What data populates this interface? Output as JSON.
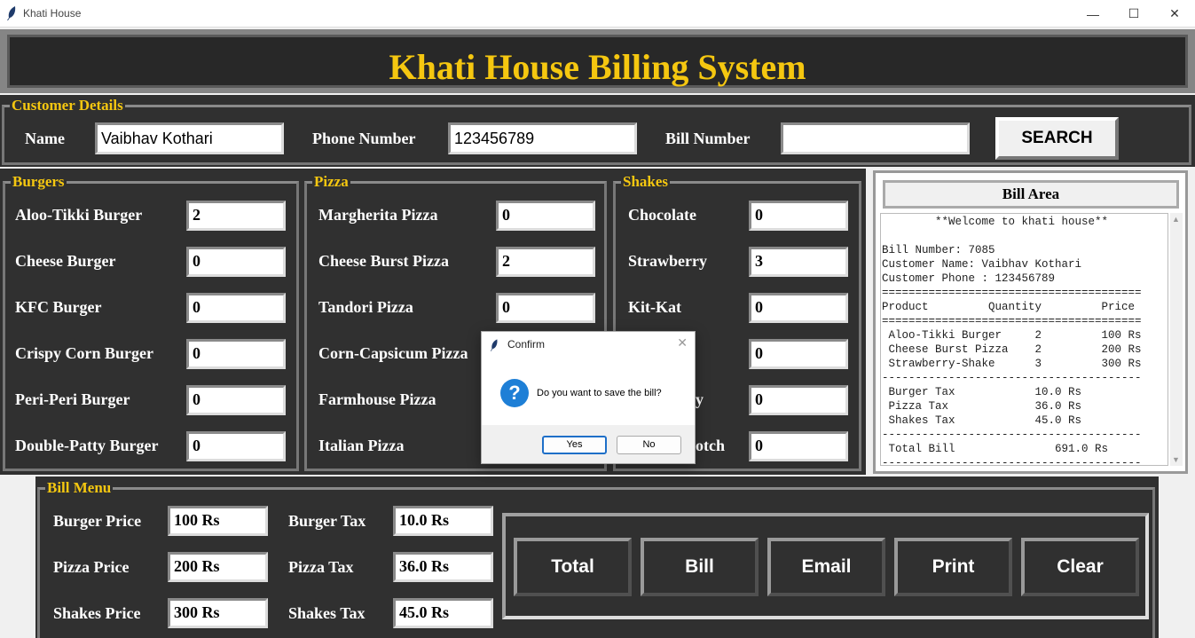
{
  "window": {
    "title": "Khati House",
    "minimize": "—",
    "maximize": "☐",
    "close": "✕"
  },
  "header": {
    "title": "Khati House Billing System"
  },
  "customer": {
    "legend": "Customer Details",
    "name_label": "Name",
    "name_value": "Vaibhav Kothari",
    "phone_label": "Phone Number",
    "phone_value": "123456789",
    "bill_label": "Bill Number",
    "bill_value": "",
    "search_label": "SEARCH"
  },
  "burgers": {
    "legend": "Burgers",
    "items": [
      {
        "label": "Aloo-Tikki Burger",
        "qty": "2"
      },
      {
        "label": "Cheese Burger",
        "qty": "0"
      },
      {
        "label": "KFC Burger",
        "qty": "0"
      },
      {
        "label": "Crispy Corn Burger",
        "qty": "0"
      },
      {
        "label": "Peri-Peri Burger",
        "qty": "0"
      },
      {
        "label": "Double-Patty Burger",
        "qty": "0"
      }
    ]
  },
  "pizza": {
    "legend": "Pizza",
    "items": [
      {
        "label": "Margherita Pizza",
        "qty": "0"
      },
      {
        "label": "Cheese Burst Pizza",
        "qty": "2"
      },
      {
        "label": "Tandori Pizza",
        "qty": "0"
      },
      {
        "label": "Corn-Capsicum Pizza",
        "qty": ""
      },
      {
        "label": "Farmhouse Pizza",
        "qty": ""
      },
      {
        "label": "Italian Pizza",
        "qty": ""
      }
    ]
  },
  "shakes": {
    "legend": "Shakes",
    "items": [
      {
        "label": "Chocolate",
        "qty": "0"
      },
      {
        "label": "Strawberry",
        "qty": "3"
      },
      {
        "label": "Kit-Kat",
        "qty": "0"
      },
      {
        "label": "",
        "qty": "0"
      },
      {
        "label": "ry",
        "qty": "0"
      },
      {
        "label": "otch",
        "qty": "0"
      }
    ]
  },
  "bill_area": {
    "title": "Bill Area",
    "lines": [
      "        **Welcome to khati house**",
      "",
      "Bill Number: 7085",
      "Customer Name: Vaibhav Kothari",
      "Customer Phone : 123456789",
      "=======================================",
      "Product         Quantity         Price",
      "=======================================",
      " Aloo-Tikki Burger     2         100 Rs",
      " Cheese Burst Pizza    2         200 Rs",
      " Strawberry-Shake      3         300 Rs",
      "---------------------------------------",
      " Burger Tax            10.0 Rs",
      " Pizza Tax             36.0 Rs",
      " Shakes Tax            45.0 Rs",
      "---------------------------------------",
      " Total Bill               691.0 Rs",
      "---------------------------------------"
    ]
  },
  "bill_menu": {
    "legend": "Bill Menu",
    "burger_price_label": "Burger Price",
    "burger_price": "100 Rs",
    "pizza_price_label": "Pizza Price",
    "pizza_price": "200 Rs",
    "shakes_price_label": "Shakes Price",
    "shakes_price": "300 Rs",
    "burger_tax_label": "Burger Tax",
    "burger_tax": "10.0 Rs",
    "pizza_tax_label": "Pizza Tax",
    "pizza_tax": "36.0 Rs",
    "shakes_tax_label": "Shakes Tax",
    "shakes_tax": "45.0 Rs",
    "buttons": [
      "Total",
      "Bill",
      "Email",
      "Print",
      "Clear"
    ]
  },
  "dialog": {
    "title": "Confirm",
    "message": "Do you want to save the bill?",
    "yes": "Yes",
    "no": "No",
    "icon": "?"
  },
  "colors": {
    "panel": "#303030",
    "accent": "#f5c710",
    "dialog_accent": "#1e7fd6"
  }
}
